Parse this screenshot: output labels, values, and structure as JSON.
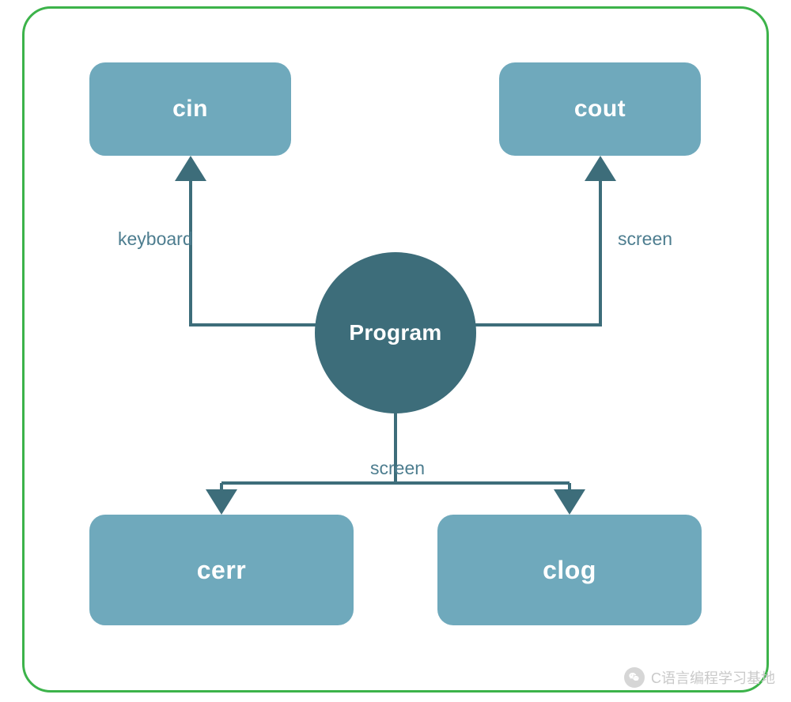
{
  "diagram": {
    "center": {
      "label": "Program"
    },
    "nodes": {
      "cin": {
        "label": "cin"
      },
      "cout": {
        "label": "cout"
      },
      "cerr": {
        "label": "cerr"
      },
      "clog": {
        "label": "clog"
      }
    },
    "edges": {
      "keyboard": {
        "label": "keyboard"
      },
      "screen_top": {
        "label": "screen"
      },
      "screen_bottom": {
        "label": "screen"
      }
    },
    "colors": {
      "border": "#3cb34a",
      "node_bg": "#6fa9bc",
      "center_bg": "#3d6d7a",
      "edge": "#3d6d7a",
      "label": "#4d7d8f"
    }
  },
  "watermark": {
    "text": "C语言编程学习基地"
  }
}
